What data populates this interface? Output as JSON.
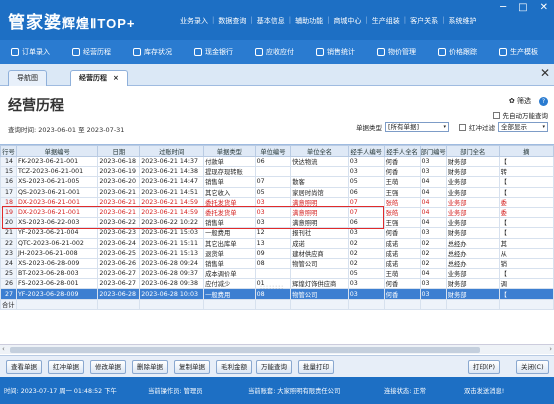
{
  "app": {
    "logo": "管家婆",
    "logo_sub": "辉煌ⅡTOP+",
    "menu": [
      "业务录入",
      "数据查询",
      "基本信息",
      "辅助功能",
      "商城中心",
      "生产组装",
      "客户关系",
      "系统维护"
    ],
    "win_min": "─",
    "win_max": "□",
    "win_close": "✕"
  },
  "toolbar": [
    "订单录入",
    "经营历程",
    "库存状况",
    "现金银行",
    "应收应付",
    "销售统计",
    "物价管理",
    "价格跟踪",
    "生产模板"
  ],
  "tabs": {
    "nav": "导航图",
    "active": "经营历程",
    "close": "×",
    "close_right": "✕"
  },
  "header": {
    "title": "经营历程",
    "query_time": "查询时间: 2023-06-01 至 2023-07-31",
    "filter_label": "筛选",
    "help": "?",
    "auto_refresh": "先自动万能查询",
    "bill_type_label": "单据类型",
    "bill_type_value": "[所有单据]",
    "red_filter_label": "红冲过滤",
    "red_filter_value": "全部显示",
    "dd": "▾"
  },
  "grid": {
    "columns": [
      "行号",
      "单据编号",
      "日期",
      "过账时间",
      "单据类型",
      "单位编号",
      "单位全名",
      "经手人编号",
      "经手人全名",
      "部门编号",
      "部门全名",
      "摘"
    ],
    "rows": [
      [
        "14",
        "FK-2023-06-21-001",
        "2023-06-18",
        "2023-06-21 14:37",
        "付款单",
        "06",
        "快达物流",
        "03",
        "何香",
        "03",
        "财务部",
        "【"
      ],
      [
        "15",
        "TCZ-2023-06-21-001",
        "2023-06-19",
        "2023-06-21 14:38",
        "提现存现转账",
        "",
        "",
        "03",
        "何香",
        "03",
        "财务部",
        "转"
      ],
      [
        "16",
        "XS-2023-06-21-005",
        "2023-06-20",
        "2023-06-21 14:47",
        "销售单",
        "07",
        "散客",
        "05",
        "王萌",
        "04",
        "业务部",
        "【"
      ],
      [
        "17",
        "QS-2023-06-21-001",
        "2023-06-21",
        "2023-06-21 14:51",
        "其它收入",
        "05",
        "家居时尚馆",
        "06",
        "王强",
        "04",
        "业务部",
        "【"
      ],
      [
        "18",
        "DX-2023-06-21-001",
        "2023-06-21",
        "2023-06-21 14:59",
        "委托发货单",
        "03",
        "满意照明",
        "07",
        "张皓",
        "04",
        "业务部",
        "委"
      ],
      [
        "19",
        "DX-2023-06-21-001",
        "2023-06-21",
        "2023-06-21 14:59",
        "委托发货单",
        "03",
        "满意照明",
        "07",
        "张皓",
        "04",
        "业务部",
        "委"
      ],
      [
        "20",
        "XS-2023-06-22-003",
        "2023-06-22",
        "2023-06-22 10:22",
        "销售单",
        "03",
        "满意照明",
        "06",
        "王强",
        "04",
        "业务部",
        "【"
      ],
      [
        "21",
        "YF-2023-06-21-004",
        "2023-06-23",
        "2023-06-21 15:03",
        "一般费用",
        "12",
        "报刊社",
        "03",
        "何香",
        "03",
        "财务部",
        "【"
      ],
      [
        "22",
        "QTC-2023-06-21-002",
        "2023-06-24",
        "2023-06-21 15:11",
        "其它出库单",
        "13",
        "成诺",
        "02",
        "成诺",
        "02",
        "总经办",
        "其"
      ],
      [
        "23",
        "JH-2023-06-21-008",
        "2023-06-25",
        "2023-06-21 15:13",
        "退货单",
        "09",
        "建材供应商",
        "02",
        "成诺",
        "02",
        "总经办",
        "从"
      ],
      [
        "24",
        "XS-2023-06-28-009",
        "2023-06-26",
        "2023-06-28 09:24",
        "销售单",
        "08",
        "物管公司",
        "02",
        "成诺",
        "02",
        "总经办",
        "销"
      ],
      [
        "25",
        "BT-2023-06-28-003",
        "2023-06-27",
        "2023-06-28 09:37",
        "成本调价单",
        "",
        "",
        "05",
        "王萌",
        "04",
        "业务部",
        "【"
      ],
      [
        "26",
        "FS-2023-06-28-001",
        "2023-06-27",
        "2023-06-28 09:38",
        "应付减少",
        "01",
        "辉煌灯饰供应商",
        "03",
        "何香",
        "03",
        "财务部",
        "调"
      ],
      [
        "27",
        "YF-2023-06-28-009",
        "2023-06-28",
        "2023-06-28 10:03",
        "一般费用",
        "08",
        "物管公司",
        "03",
        "何香",
        "03",
        "财务部",
        "【"
      ]
    ],
    "sum_label": "合计",
    "scroll_left": "‹",
    "scroll_right": "›",
    "dots": "::::::::"
  },
  "buttons": [
    "查看单据",
    "红冲单据",
    "修改单据",
    "删除单据",
    "复制单据",
    "毛利金额",
    "万能查询",
    "批量打印"
  ],
  "buttons_right": [
    "打印(P)",
    "关闭(C)"
  ],
  "status": {
    "time": "时间: 2023-07-17 周一 01:48:52 下午",
    "operator": "当前操作员: 管理员",
    "account": "当前账套: 大家照明有限责任公司",
    "conn": "连接状态: 正常",
    "msg": "双击发送消息!"
  }
}
